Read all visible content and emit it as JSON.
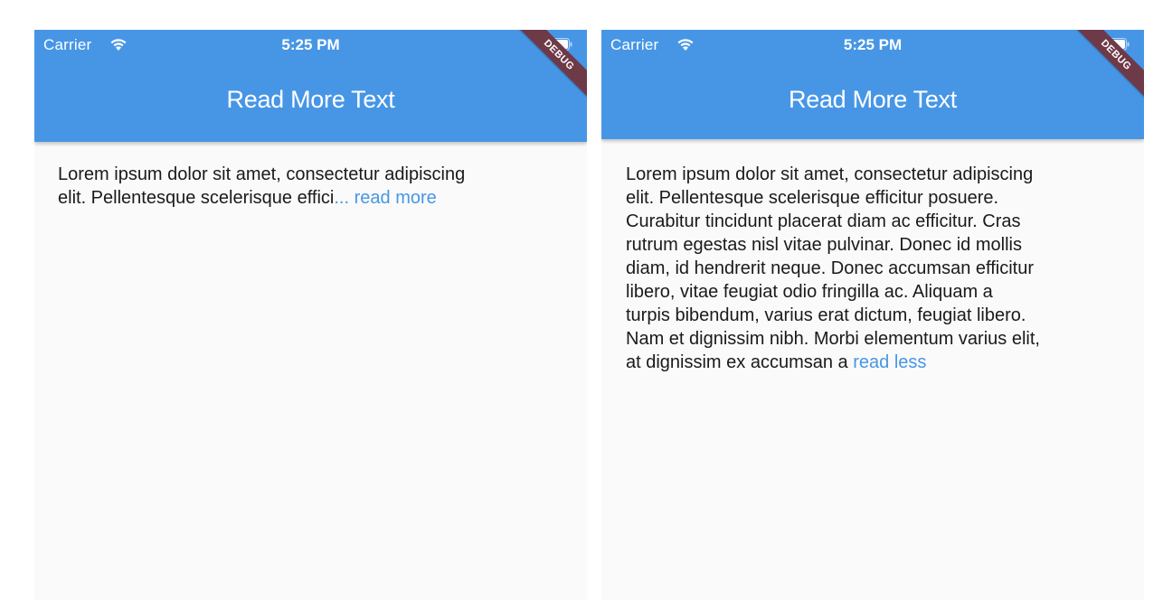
{
  "colors": {
    "appbar": "#4796e6",
    "link": "#4796e6",
    "background": "#fafafa",
    "debug_ribbon": "#6e3a48"
  },
  "screens": [
    {
      "status": {
        "carrier": "Carrier",
        "time": "5:25 PM"
      },
      "debug_label": "DEBUG",
      "title": "Read More Text",
      "body_line1": "Lorem ipsum dolor sit amet, consectetur adipiscing",
      "body_line2": "elit. Pellentesque scelerisque effici",
      "toggle_link": "... read more"
    },
    {
      "status": {
        "carrier": "Carrier",
        "time": "5:25 PM"
      },
      "debug_label": "DEBUG",
      "title": "Read More Text",
      "lines": [
        "Lorem ipsum dolor sit amet, consectetur adipiscing",
        "elit. Pellentesque scelerisque efficitur posuere.",
        "Curabitur tincidunt placerat diam ac efficitur. Cras",
        "rutrum egestas nisl vitae pulvinar. Donec id mollis",
        "diam, id hendrerit neque. Donec accumsan efficitur",
        "libero, vitae feugiat odio fringilla ac. Aliquam a",
        "turpis bibendum, varius erat dictum, feugiat libero.",
        "Nam et dignissim nibh. Morbi elementum varius elit,",
        "at dignissim ex accumsan a "
      ],
      "toggle_link": "read less"
    }
  ]
}
